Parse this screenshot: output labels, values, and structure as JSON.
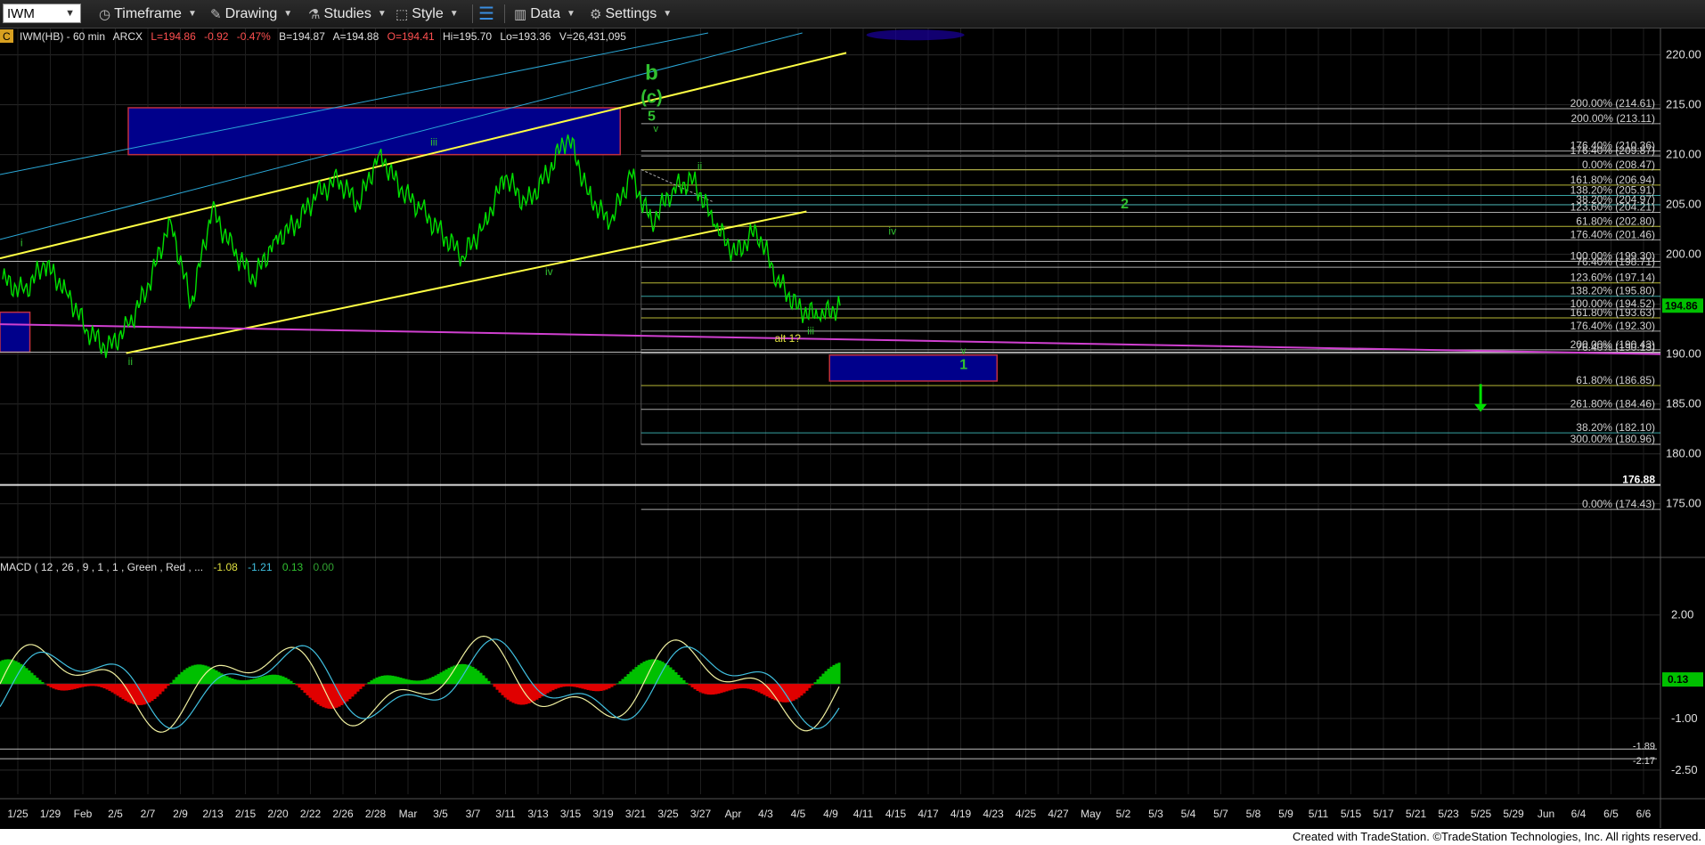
{
  "toolbar": {
    "symbol": "IWM",
    "timeframe": "Timeframe",
    "drawing": "Drawing",
    "studies": "Studies",
    "style": "Style",
    "data": "Data",
    "settings": "Settings"
  },
  "header": {
    "badge": "C",
    "symbol_desc": "IWM(HB) - 60 min",
    "exchange": "ARCX",
    "last": "L=194.86",
    "change": "-0.92",
    "pct": "-0.47%",
    "bid": "B=194.87",
    "ask": "A=194.88",
    "open": "O=194.41",
    "high": "Hi=195.70",
    "low": "Lo=193.36",
    "volume": "V=26,431,095"
  },
  "macd": {
    "label": "MACD ( 12 , 26 , 9 , 1 , 1 , Green , Red , ...",
    "v1": "-1.08",
    "v2": "-1.21",
    "v3": "0.13",
    "v4": "0.00"
  },
  "footer": "Created with TradeStation. ©TradeStation Technologies, Inc. All rights reserved.",
  "colors": {
    "price": "#00e000",
    "channel": "#ffff44",
    "cyan": "#2aa8d8",
    "magenta": "#d040d0",
    "box": "#00008b",
    "label_green": "#30c030"
  },
  "chart_data": {
    "type": "line",
    "title": "",
    "ylim": [
      170.6,
      222.2
    ],
    "y_ticks": [
      175,
      180,
      185,
      190,
      195,
      200,
      205,
      210,
      215,
      220
    ],
    "x_ticks": [
      "1/25",
      "1/29",
      "Feb",
      "2/5",
      "2/7",
      "2/9",
      "2/13",
      "2/15",
      "2/20",
      "2/22",
      "2/26",
      "2/28",
      "Mar",
      "3/5",
      "3/7",
      "3/11",
      "3/13",
      "3/15",
      "3/19",
      "3/21",
      "3/25",
      "3/27",
      "Apr",
      "4/3",
      "4/5",
      "4/9",
      "4/11",
      "4/15",
      "4/17",
      "4/19",
      "4/23",
      "4/25",
      "4/27",
      "May",
      "5/2",
      "5/3",
      "5/4",
      "5/7",
      "5/8",
      "5/9",
      "5/11",
      "5/15",
      "5/17",
      "5/21",
      "5/23",
      "5/25",
      "5/29",
      "Jun",
      "6/4",
      "6/5",
      "6/6"
    ],
    "last_price": "194.86",
    "price_series": [
      [
        0,
        197.5
      ],
      [
        1,
        196.2
      ],
      [
        2,
        199.0
      ],
      [
        3,
        196.5
      ],
      [
        4,
        192.5
      ],
      [
        5,
        190.5
      ],
      [
        6,
        192.8
      ],
      [
        7,
        197.0
      ],
      [
        8,
        203.5
      ],
      [
        9,
        195.0
      ],
      [
        10,
        204.5
      ],
      [
        11,
        200.5
      ],
      [
        12,
        197.5
      ],
      [
        13,
        201.5
      ],
      [
        14,
        203.0
      ],
      [
        15,
        206.0
      ],
      [
        16,
        207.5
      ],
      [
        17,
        205.0
      ],
      [
        18,
        210.2
      ],
      [
        19,
        206.5
      ],
      [
        20,
        204.5
      ],
      [
        21,
        202.0
      ],
      [
        22,
        199.8
      ],
      [
        23,
        203.0
      ],
      [
        24,
        207.8
      ],
      [
        25,
        205.0
      ],
      [
        26,
        208.0
      ],
      [
        27,
        212.0
      ],
      [
        28,
        206.0
      ],
      [
        29,
        203.0
      ],
      [
        30,
        208.0
      ],
      [
        31,
        203.2
      ],
      [
        32,
        206.5
      ],
      [
        33,
        207.5
      ],
      [
        34,
        203.0
      ],
      [
        35,
        200.0
      ],
      [
        36,
        202.5
      ],
      [
        37,
        197.5
      ],
      [
        38,
        194.6
      ],
      [
        39,
        193.7
      ],
      [
        40,
        194.86
      ]
    ],
    "fib_levels": [
      {
        "pct": "200.00%",
        "value": "214.61",
        "y": 214.61,
        "color": "#c8c8c8"
      },
      {
        "pct": "200.00%",
        "value": "213.11",
        "y": 213.11,
        "color": "#c8c8c8"
      },
      {
        "pct": "176.40%",
        "value": "210.36",
        "y": 210.36,
        "color": "#c8c8c8"
      },
      {
        "pct": "176.40%",
        "value": "209.87",
        "y": 209.87,
        "color": "#c8c8c8"
      },
      {
        "pct": "0.00%",
        "value": "208.47",
        "y": 208.47,
        "color": "#d8d840"
      },
      {
        "pct": "161.80%",
        "value": "206.94",
        "y": 206.94,
        "color": "#d8d840"
      },
      {
        "pct": "138.20%",
        "value": "205.91",
        "y": 205.91,
        "color": "#40c0c0"
      },
      {
        "pct": "38.20%",
        "value": "204.97",
        "y": 204.97,
        "color": "#40c0c0"
      },
      {
        "pct": "123.60%",
        "value": "204.21",
        "y": 204.21,
        "color": "#c8c8c8"
      },
      {
        "pct": "61.80%",
        "value": "202.80",
        "y": 202.8,
        "color": "#d8d840"
      },
      {
        "pct": "176.40%",
        "value": "201.46",
        "y": 201.46,
        "color": "#c8c8c8"
      },
      {
        "pct": "100.00%",
        "value": "199.30",
        "y": 199.3,
        "color": "#c8c8c8"
      },
      {
        "pct": "76.40%",
        "value": "198.71",
        "y": 198.71,
        "color": "#c8c8c8"
      },
      {
        "pct": "123.60%",
        "value": "197.14",
        "y": 197.14,
        "color": "#d8d840"
      },
      {
        "pct": "138.20%",
        "value": "195.80",
        "y": 195.8,
        "color": "#40c0c0"
      },
      {
        "pct": "100.00%",
        "value": "194.52",
        "y": 194.52,
        "color": "#c8c8c8"
      },
      {
        "pct": "161.80%",
        "value": "193.63",
        "y": 193.63,
        "color": "#d8d840"
      },
      {
        "pct": "176.40%",
        "value": "192.30",
        "y": 192.3,
        "color": "#c8c8c8"
      },
      {
        "pct": "200.00%",
        "value": "190.43",
        "y": 190.43,
        "color": "#c8c8c8"
      },
      {
        "pct": "76.40%",
        "value": "190.13",
        "y": 190.13,
        "color": "#c8c8c8"
      },
      {
        "pct": "61.80%",
        "value": "186.85",
        "y": 186.85,
        "color": "#d8d840"
      },
      {
        "pct": "261.80%",
        "value": "184.46",
        "y": 184.46,
        "color": "#c8c8c8"
      },
      {
        "pct": "38.20%",
        "value": "182.10",
        "y": 182.1,
        "color": "#40c0c0"
      },
      {
        "pct": "300.00%",
        "value": "180.96",
        "y": 180.96,
        "color": "#c8c8c8"
      },
      {
        "pct": "",
        "value": "176.88",
        "y": 176.88,
        "color": "#ffffff"
      },
      {
        "pct": "0.00%",
        "value": "174.43",
        "y": 174.43,
        "color": "#c8c8c8"
      }
    ],
    "wave_labels": [
      {
        "text": "b",
        "x": 31,
        "y": 217.5,
        "color": "#30c030",
        "size": 24,
        "bold": true
      },
      {
        "text": "(c)",
        "x": 31,
        "y": 215.2,
        "color": "#30c030",
        "size": 20,
        "bold": true
      },
      {
        "text": "5",
        "x": 31,
        "y": 213.4,
        "color": "#30c030",
        "size": 16,
        "bold": true
      },
      {
        "text": "v",
        "x": 31.2,
        "y": 212.3,
        "color": "#30c030",
        "size": 11,
        "bold": false
      },
      {
        "text": "iii",
        "x": 20.6,
        "y": 210.9,
        "color": "#30c030",
        "size": 12,
        "bold": false
      },
      {
        "text": "ii",
        "x": 33.3,
        "y": 208.5,
        "color": "#30c030",
        "size": 12,
        "bold": false
      },
      {
        "text": "iv",
        "x": 26.1,
        "y": 197.9,
        "color": "#30c030",
        "size": 12,
        "bold": false
      },
      {
        "text": "i",
        "x": 0.9,
        "y": 200.8,
        "color": "#30c030",
        "size": 12,
        "bold": false
      },
      {
        "text": "ii",
        "x": 6.1,
        "y": 188.9,
        "color": "#30c030",
        "size": 12,
        "bold": false
      },
      {
        "text": "iii",
        "x": 38.6,
        "y": 192.0,
        "color": "#30c030",
        "size": 12,
        "bold": false
      },
      {
        "text": "alt 1?",
        "x": 37.5,
        "y": 191.2,
        "color": "#e0e040",
        "size": 12,
        "bold": false
      },
      {
        "text": "iv",
        "x": 42.5,
        "y": 202.0,
        "color": "#30c030",
        "size": 12,
        "bold": false
      },
      {
        "text": "2",
        "x": 53.6,
        "y": 204.6,
        "color": "#30c030",
        "size": 16,
        "bold": true
      },
      {
        "text": "v",
        "x": 45.9,
        "y": 190.0,
        "color": "#30c030",
        "size": 11,
        "bold": false
      },
      {
        "text": "1",
        "x": 45.9,
        "y": 188.5,
        "color": "#30c030",
        "size": 16,
        "bold": true
      }
    ]
  }
}
